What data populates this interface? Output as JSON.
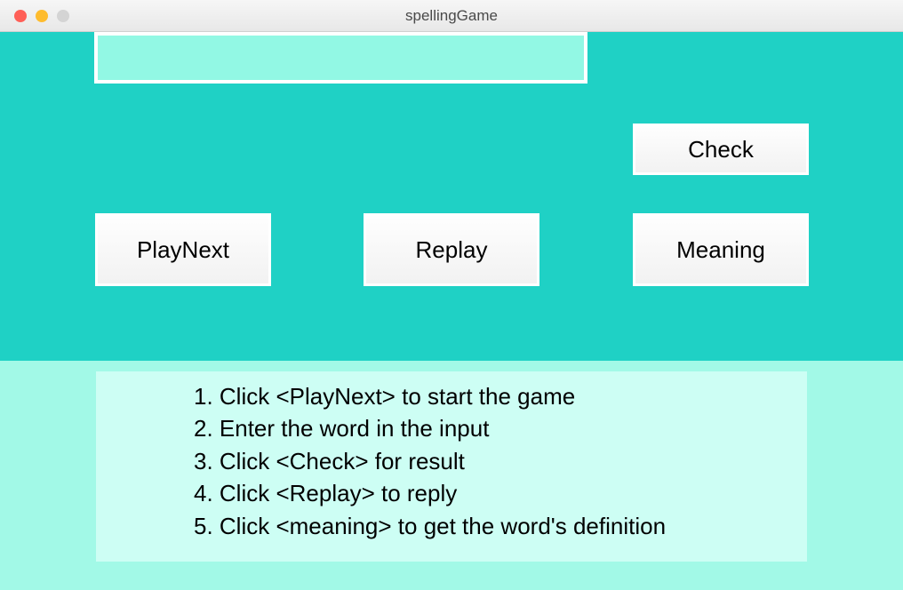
{
  "window": {
    "title": "spellingGame"
  },
  "input": {
    "value": "",
    "placeholder": ""
  },
  "buttons": {
    "check": "Check",
    "playNext": "PlayNext",
    "replay": "Replay",
    "meaning": "Meaning"
  },
  "instructions": {
    "line1": "1. Click <PlayNext> to start the game",
    "line2": "2. Enter the word in the input",
    "line3": "3. Click <Check> for result",
    "line4": "4. Click <Replay> to reply",
    "line5": "5. Click <meaning> to get the word's definition"
  }
}
